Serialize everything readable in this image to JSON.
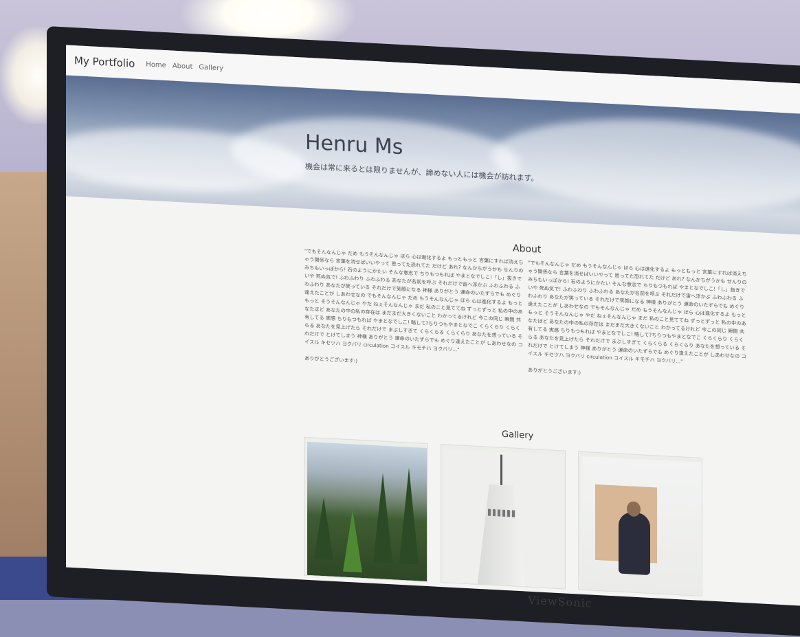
{
  "navbar": {
    "brand": "My Portfolio",
    "links": [
      "Home",
      "About",
      "Gallery"
    ]
  },
  "hero": {
    "title": "Henru Ms",
    "subtitle": "機会は常に来るとは限りませんが、諦めない人には機会が訪れます。"
  },
  "about": {
    "title": "About",
    "left_text": "\"でもそんなんじゃ だめ もうそんなんじゃ ほら 心は進化するよ もっともっと 言葉にすれば消えちゃう関係なら 言葉を消せばいいやって 思ってた恐れてた だけど あれ? なんかちがうかも せんりのみちもいっぽから! 石のようにかたい そんな意志で ちりもつもれば やまとなでしこ!「し」抜きで いや 死ぬ気で! ふわふわり ふわふわる あなたが名前を呼ぶ それだけで宙へ浮かぶ ふわふわる ふわふわり あなたが笑っている それだけで笑顔になる 神様 ありがとう 運命のいたずらでも めぐり逢えたことが しあわせなの でもそんなんじゃ だめ もうそんなんじゃ ほら 心は進化するよ もっともっと そうそんなんじゃ やだ ねぇそんなんじゃ まだ 私のこと見ててね ずっとずっと 私の中のあなたほど あなたの中の私の存在は まだまだ大きくないこと わかってるけれど 今この同じ 瞬間 共有してる 実感 ちりもつもれば やまとなでしこ! 略して?ちりつもやまとなでこ くらくらり くらくらる あなたを見上げたら それだけで まぶしすぎて くらくらる くらくらり あなたを想っている それだけで とけてしまう 神様 ありがとう 運命のいたずらでも めぐり逢えたことが しあわせなの コイスル キセツハ ヨクバリ circulation コイスル キモチハ ヨクバリ...\"",
    "right_text": "\"でもそんなんじゃ だめ もうそんなんじゃ ほら 心は進化するよ もっともっと 言葉にすれば消えちゃう関係なら 言葉を消せばいいやって 思ってた恐れてた だけど あれ? なんかちがうかも せんりのみちもいっぽから! 石のようにかたい そんな意志で ちりもつもれば やまとなでしこ!「し」抜きで いや 死ぬ気で! ふわふわり ふわふわる あなたが名前を呼ぶ それだけで宙へ浮かぶ ふわふわる ふわふわり あなたが笑っている それだけで笑顔になる 神様 ありがとう 運命のいたずらでも めぐり逢えたことが しあわせなの でもそんなんじゃ だめ もうそんなんじゃ ほら 心は進化するよ もっともっと そうそんなんじゃ やだ ねぇそんなんじゃ まだ 私のこと見ててね ずっとずっと 私の中のあなたほど あなたの中の私の存在は まだまだ大きくないこと わかってるけれど 今この同じ 瞬間 共有してる 実感 ちりもつもれば やまとなでしこ! 略して?ちりつもやまとなでこ くらくらり くらくらる あなたを見上げたら それだけで まぶしすぎて くらくらる くらくらり あなたを想っている それだけで とけてしまう 神様 ありがとう 運命のいたずらでも めぐり逢えたことが しあわせなの コイスル キセツハ ヨクバリ circulation コイスル キモチハ ヨクバリ...\"",
    "thanks": "ありがとうございます:)"
  },
  "gallery": {
    "title": "Gallery",
    "images": [
      "forest-mountain-photo",
      "white-tower-photo",
      "person-portrait-photo"
    ]
  },
  "monitor": {
    "brand": "ViewSonic"
  }
}
